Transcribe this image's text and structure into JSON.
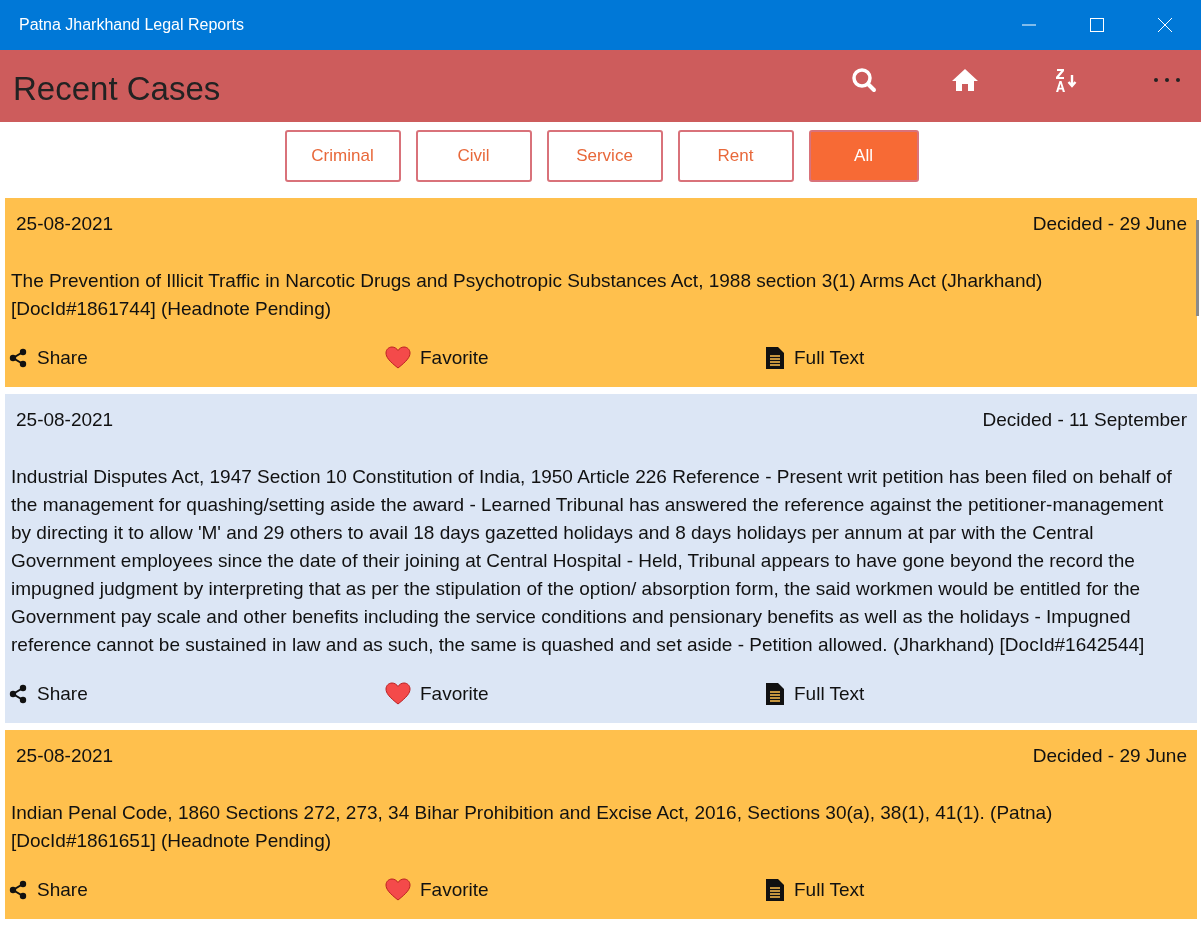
{
  "window": {
    "title": "Patna Jharkhand Legal Reports"
  },
  "toolbar": {
    "title": "Recent Cases"
  },
  "filters": [
    {
      "label": "Criminal",
      "selected": false
    },
    {
      "label": "Civil",
      "selected": false
    },
    {
      "label": "Service",
      "selected": false
    },
    {
      "label": "Rent",
      "selected": false
    },
    {
      "label": "All",
      "selected": true
    }
  ],
  "cases": [
    {
      "date": "25-08-2021",
      "decided": "Decided - 29 June",
      "color": "#ffc04d",
      "text": "The Prevention of Illicit Traffic in Narcotic Drugs and Psychotropic Substances Act, 1988 section 3(1) Arms Act  (Jharkhand) [DocId#1861744] (Headnote Pending)",
      "actions": [
        {
          "kind": "share",
          "label": "Share"
        },
        {
          "kind": "favorite",
          "label": "Favorite"
        },
        {
          "kind": "fulltext",
          "label": "Full Text"
        }
      ]
    },
    {
      "date": "25-08-2021",
      "decided": "Decided - 11 September",
      "color": "#dce6f5",
      "text": "Industrial Disputes Act, 1947 Section 10 Constitution of India, 1950 Article 226 Reference - Present writ petition has been filed on behalf of the management for quashing/setting aside the award - Learned Tribunal has answered the reference against the petitioner-management by directing it to allow 'M' and 29 others to avail 18 days gazetted holidays and 8 days holidays per annum at par with the Central Government employees since the date of their joining at Central Hospital - Held, Tribunal appears to have gone beyond the record the impugned judgment by interpreting that as per the stipulation of the option/ absorption form, the said workmen would be entitled for the Government pay scale and other benefits including the service conditions and pensionary benefits as well as the holidays - Impugned reference cannot be sustained in law and as such, the same is quashed and set aside - Petition allowed. (Jharkhand) [DocId#1642544]",
      "actions": [
        {
          "kind": "share",
          "label": "Share"
        },
        {
          "kind": "favorite",
          "label": "Favorite"
        },
        {
          "kind": "fulltext",
          "label": "Full Text"
        }
      ]
    },
    {
      "date": "25-08-2021",
      "decided": "Decided - 29 June",
      "color": "#ffc04d",
      "text": "Indian Penal Code, 1860 Sections 272, 273, 34 Bihar Prohibition and Excise Act, 2016, Sections 30(a), 38(1), 41(1). (Patna) [DocId#1861651] (Headnote Pending)",
      "actions": [
        {
          "kind": "share",
          "label": "Share"
        },
        {
          "kind": "favorite",
          "label": "Favorite"
        },
        {
          "kind": "fulltext",
          "label": "Full Text"
        }
      ]
    }
  ]
}
